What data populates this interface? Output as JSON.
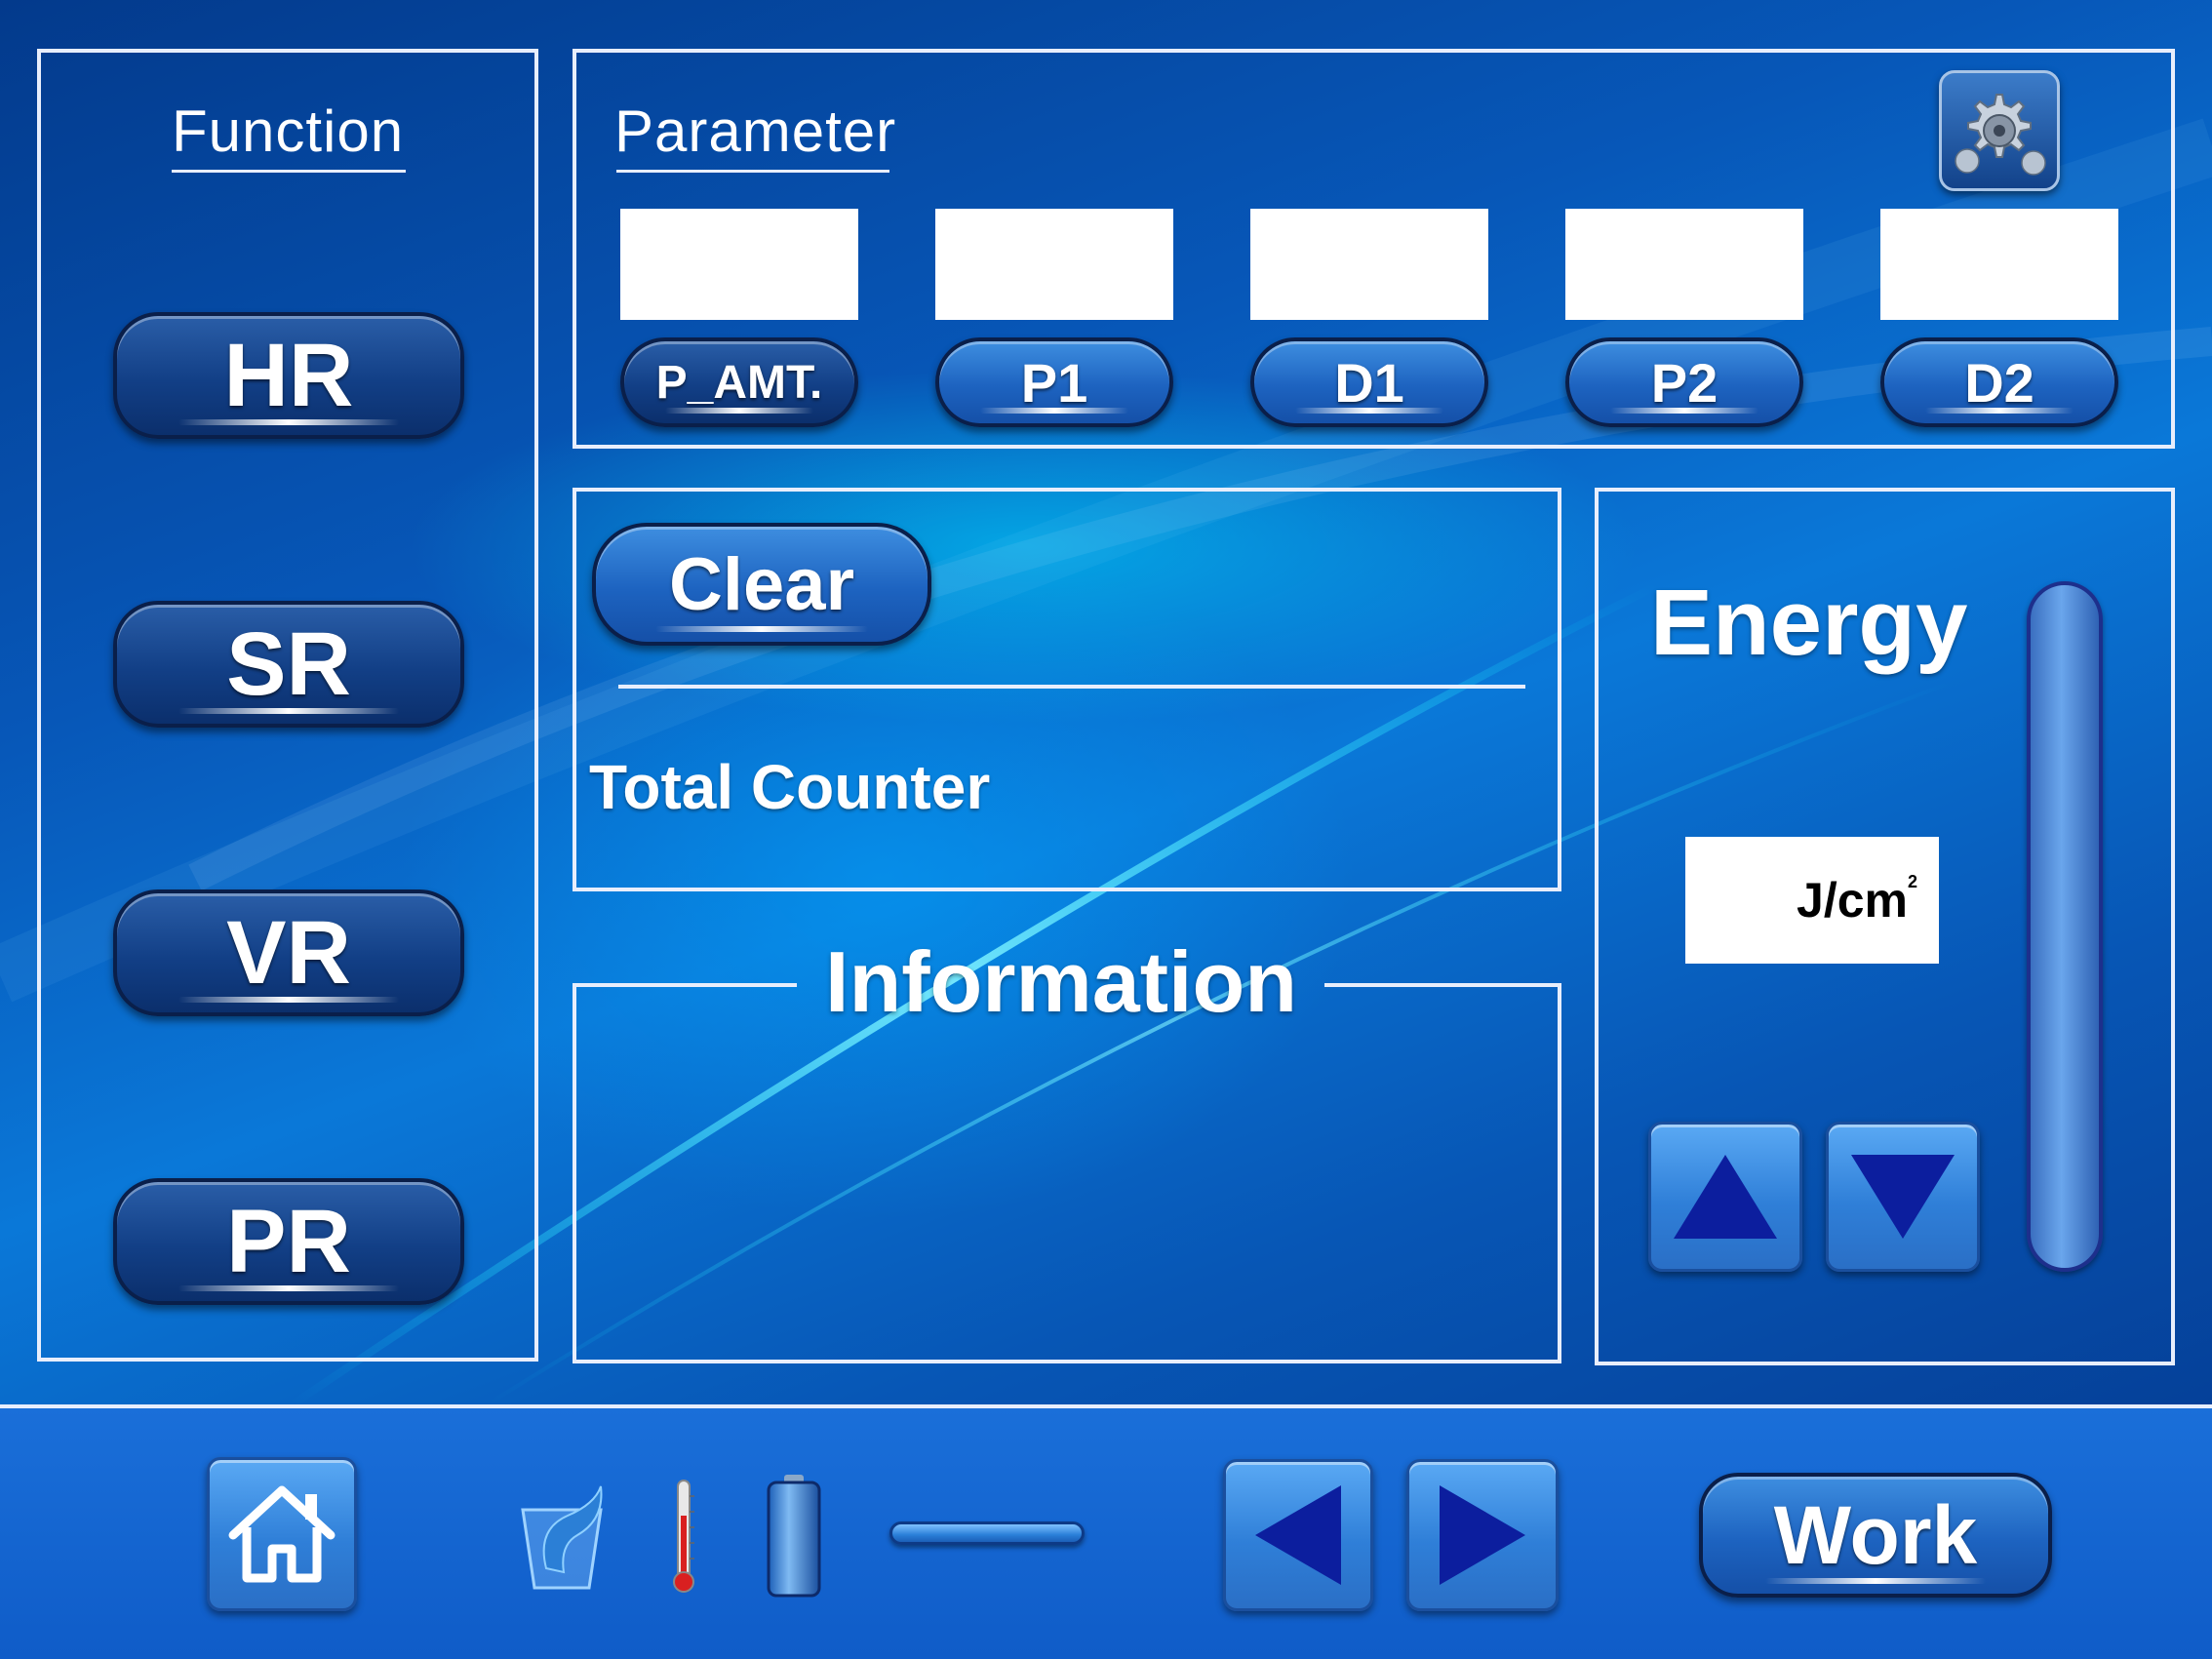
{
  "function_panel": {
    "title": "Function",
    "buttons": [
      {
        "label": "HR"
      },
      {
        "label": "SR"
      },
      {
        "label": "VR"
      },
      {
        "label": "PR"
      }
    ]
  },
  "parameter_panel": {
    "title": "Parameter",
    "settings_icon": "gear-icon",
    "params": [
      {
        "label": "P_AMT.",
        "value": ""
      },
      {
        "label": "P1",
        "value": ""
      },
      {
        "label": "D1",
        "value": ""
      },
      {
        "label": "P2",
        "value": ""
      },
      {
        "label": "D2",
        "value": ""
      }
    ]
  },
  "counter_panel": {
    "clear_label": "Clear",
    "total_counter_label": "Total Counter"
  },
  "information_panel": {
    "title": "Information"
  },
  "energy_panel": {
    "title": "Energy",
    "unit_base": "J/cm",
    "unit_exp": "2",
    "value": "",
    "up_icon": "triangle-up-icon",
    "down_icon": "triangle-down-icon"
  },
  "bottom_bar": {
    "home_icon": "home-icon",
    "water_icon": "water-cup-icon",
    "temperature_icon": "thermometer-icon",
    "battery_icon": "battery-icon",
    "prev_icon": "triangle-left-icon",
    "next_icon": "triangle-right-icon",
    "work_label": "Work"
  },
  "colors": {
    "background_dark": "#04358a",
    "background_light": "#0a78d8",
    "accent_cyan": "#00d8ff",
    "arrow_navy": "#0c1e9e",
    "panel_border": "#e8eefc"
  }
}
